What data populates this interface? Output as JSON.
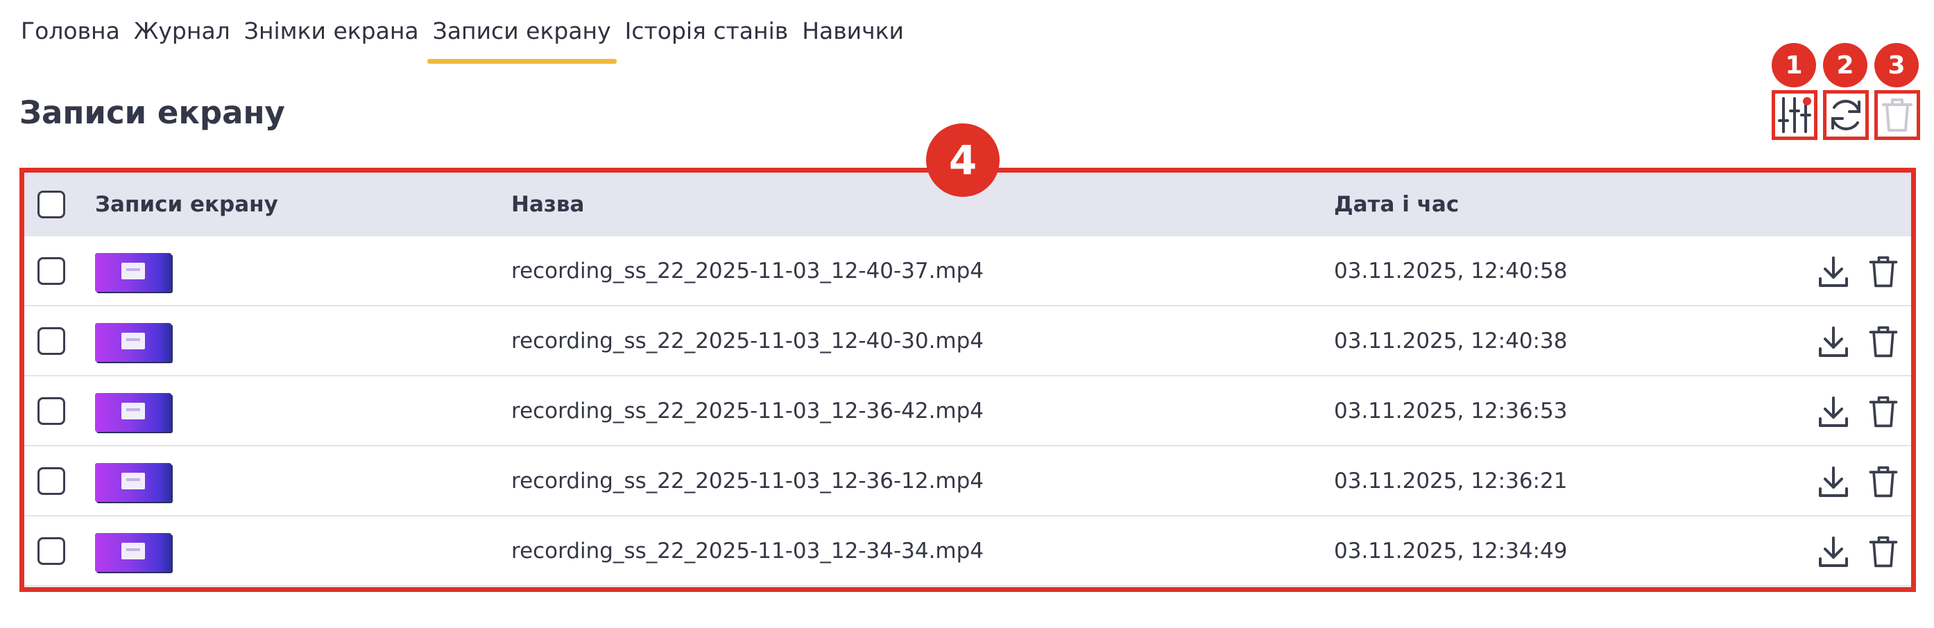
{
  "tabs": [
    {
      "label": "Головна"
    },
    {
      "label": "Журнал"
    },
    {
      "label": "Знімки екрана"
    },
    {
      "label": "Записи екрану",
      "active": true
    },
    {
      "label": "Історія станів"
    },
    {
      "label": "Навички"
    }
  ],
  "page_title": "Записи екрану",
  "toolbar": {
    "filter_icon": "sliders-icon",
    "refresh_icon": "refresh-icon",
    "delete_icon": "trash-icon",
    "badges": [
      "1",
      "2",
      "3"
    ]
  },
  "table_badge": "4",
  "table": {
    "headers": {
      "preview": "Записи екрану",
      "name": "Назва",
      "datetime": "Дата і час"
    },
    "rows": [
      {
        "name": "recording_ss_22_2025-11-03_12-40-37.mp4",
        "datetime": "03.11.2025, 12:40:58"
      },
      {
        "name": "recording_ss_22_2025-11-03_12-40-30.mp4",
        "datetime": "03.11.2025, 12:40:38"
      },
      {
        "name": "recording_ss_22_2025-11-03_12-36-42.mp4",
        "datetime": "03.11.2025, 12:36:53"
      },
      {
        "name": "recording_ss_22_2025-11-03_12-36-12.mp4",
        "datetime": "03.11.2025, 12:36:21"
      },
      {
        "name": "recording_ss_22_2025-11-03_12-34-34.mp4",
        "datetime": "03.11.2025, 12:34:49"
      }
    ]
  },
  "colors": {
    "accent_tab": "#f1b93c",
    "highlight_red": "#e03126",
    "header_bg": "#e4e5ee",
    "text_dark": "#343748"
  }
}
